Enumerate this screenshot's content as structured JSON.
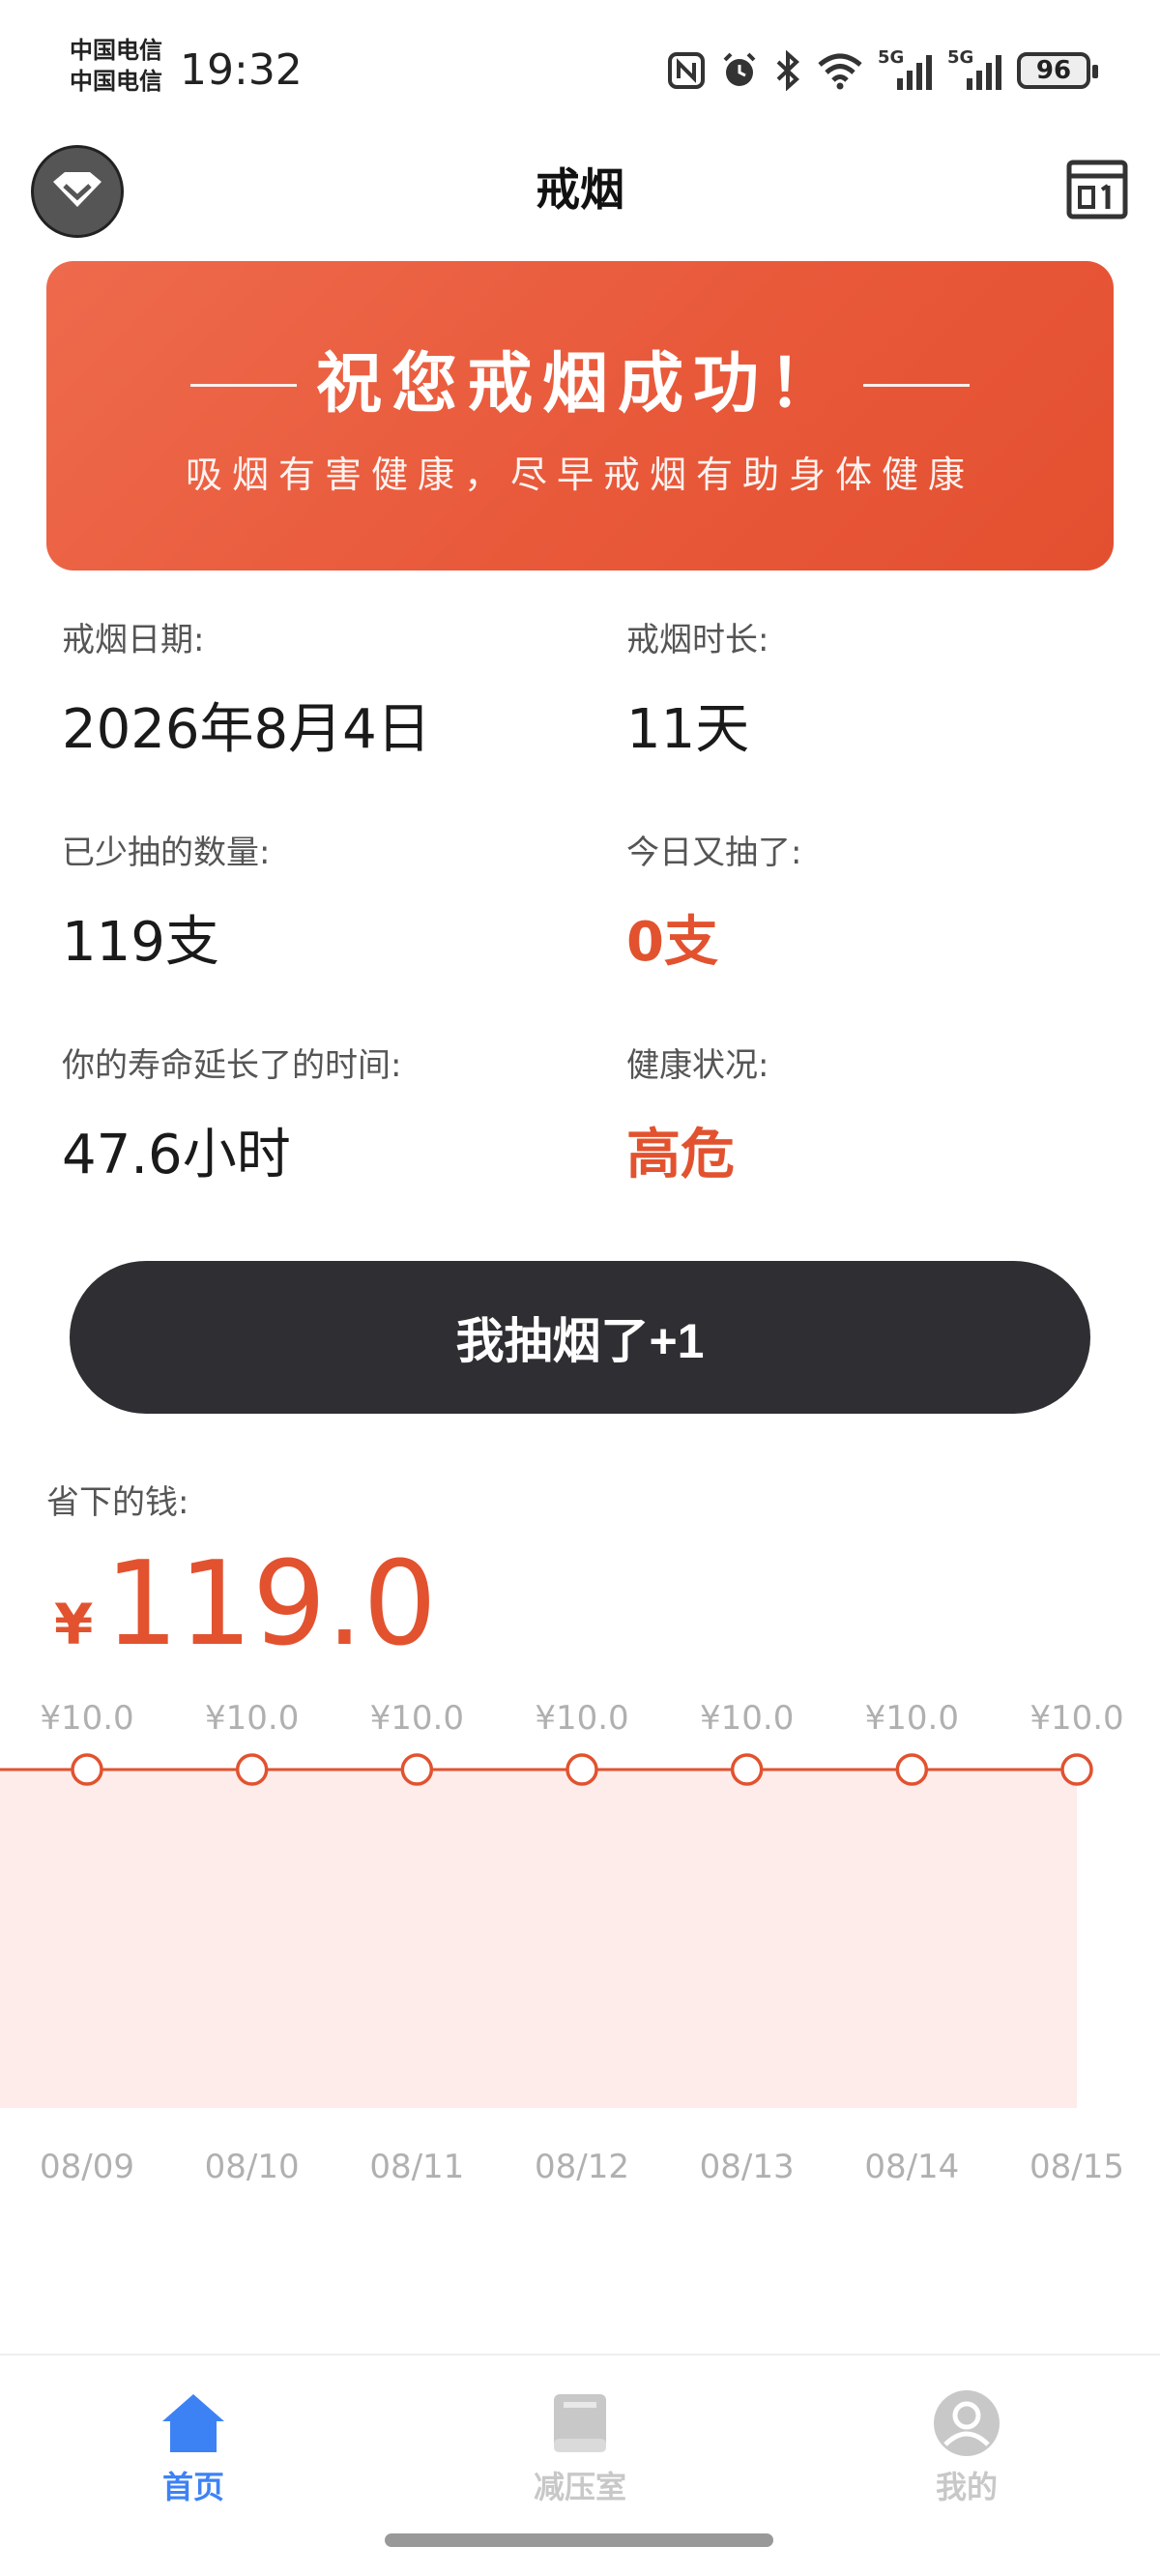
{
  "status_bar": {
    "carrier_1": "中国电信",
    "carrier_2": "中国电信",
    "time": "19:32",
    "battery": "96",
    "signal_1_label": "5G",
    "signal_2_label": "5G"
  },
  "header": {
    "title": "戒烟"
  },
  "banner": {
    "title": "祝您戒烟成功！",
    "subtitle": "吸烟有害健康，尽早戒烟有助身体健康"
  },
  "stats": {
    "quit_date_label": "戒烟日期:",
    "quit_date_value": "2026年8月4日",
    "quit_duration_label": "戒烟时长:",
    "quit_duration_value": "11天",
    "reduced_label": "已少抽的数量:",
    "reduced_value": "119支",
    "today_label": "今日又抽了:",
    "today_value": "0支",
    "life_label": "你的寿命延长了的时间:",
    "life_value": "47.6小时",
    "health_label": "健康状况:",
    "health_value": "高危"
  },
  "smoke_button": {
    "label": "我抽烟了+1"
  },
  "savings": {
    "label": "省下的钱:",
    "currency": "¥",
    "amount": "119.0"
  },
  "chart_data": {
    "type": "area",
    "categories": [
      "08/09",
      "08/10",
      "08/11",
      "08/12",
      "08/13",
      "08/14",
      "08/15"
    ],
    "values": [
      10.0,
      10.0,
      10.0,
      10.0,
      10.0,
      10.0,
      10.0
    ],
    "value_labels": [
      "¥10.0",
      "¥10.0",
      "¥10.0",
      "¥10.0",
      "¥10.0",
      "¥10.0",
      "¥10.0"
    ],
    "ylim": [
      0,
      10
    ],
    "grid": false,
    "colors": {
      "line": "#e2522f",
      "fill": "#fdecea"
    }
  },
  "bottom_nav": {
    "items": [
      {
        "label": "首页",
        "active": true
      },
      {
        "label": "减压室",
        "active": false
      },
      {
        "label": "我的",
        "active": false
      }
    ]
  },
  "colors": {
    "accent": "#e2522f",
    "nav_active": "#3d82f5",
    "nav_inactive": "#c8c8c8",
    "button_dark": "#2e2e33"
  }
}
